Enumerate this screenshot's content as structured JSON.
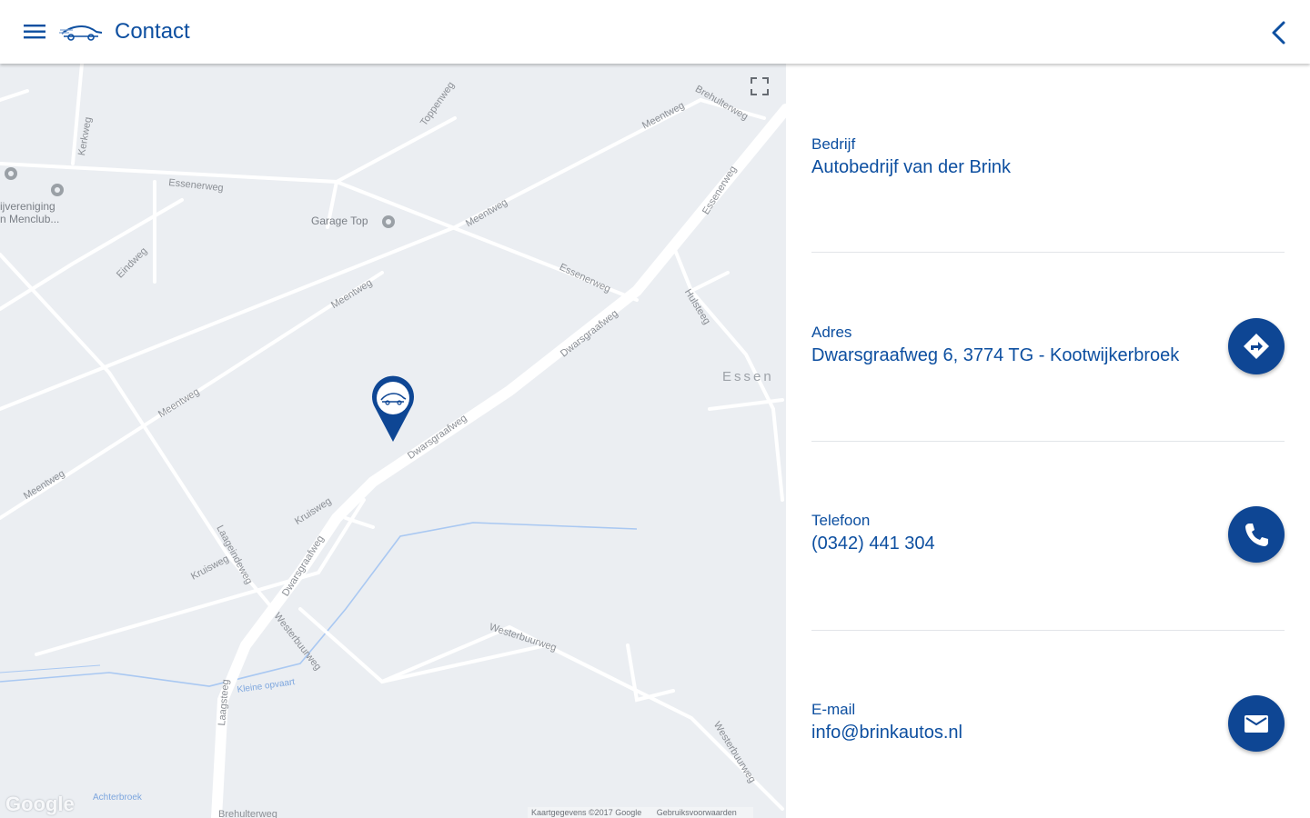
{
  "header": {
    "title": "Contact",
    "menu_icon": "hamburger-menu-icon",
    "logo_icon": "car-logo-icon",
    "back_icon": "chevron-left-icon"
  },
  "map": {
    "poi": {
      "garage": "Garage Top",
      "club_line1": "ijvereniging",
      "club_line2": "n Menclub..."
    },
    "place": "Essen",
    "streets": {
      "essenerweg_1": "Essenerweg",
      "essenerweg_2": "Essenerweg",
      "toppenweg": "Toppenweg",
      "meentweg_1": "Meentweg",
      "meentweg_2": "Meentweg",
      "meentweg_3": "Meentweg",
      "meentweg_4": "Meentweg",
      "meentweg_5": "Meentweg",
      "brehulterweg": "Brehulterweg",
      "essenerweg_3": "Essenerweg",
      "eindweg": "Eindweg",
      "hulsteeg": "Hulsteeg",
      "dwarsgraafweg_1": "Dwarsgraafweg",
      "dwarsgraafweg_2": "Dwarsgraafweg",
      "dwarsgraafweg_3": "Dwarsgraafweg",
      "kruisweg_1": "Kruisweg",
      "kruisweg_2": "Kruisweg",
      "laageinde": "Laageindeweg",
      "westerbuurweg_1": "Westerbuurweg",
      "westerbuurweg_2": "Westerbuurweg",
      "westerbuurweg_3": "Westerbuurweg",
      "laagsteeg": "Laagsteeg",
      "kerkweg": "Kerkweg",
      "brehulterweg_2": "Brehulterweg"
    },
    "water": "Kleine opvaart",
    "bottom_label": "Achterbroek",
    "google": "Google",
    "copyright": "Kaartgegevens ©2017 Google",
    "terms": "Gebruiksvoorwaarden",
    "fullscreen_icon": "fullscreen-icon",
    "marker_icon": "location-pin-icon"
  },
  "contact": {
    "company_label": "Bedrijf",
    "company_value": "Autobedrijf van der Brink",
    "address_label": "Adres",
    "address_value": "Dwarsgraafweg 6, 3774 TG - Kootwijkerbroek",
    "phone_label": "Telefoon",
    "phone_value": "(0342) 441 304",
    "email_label": "E-mail",
    "email_value": "info@brinkautos.nl",
    "directions_icon": "directions-icon",
    "phone_icon": "phone-icon",
    "email_icon": "email-icon"
  },
  "colors": {
    "brand_blue": "#0d4fa0",
    "button_blue": "#0e4694",
    "map_background": "#ebeef2"
  }
}
